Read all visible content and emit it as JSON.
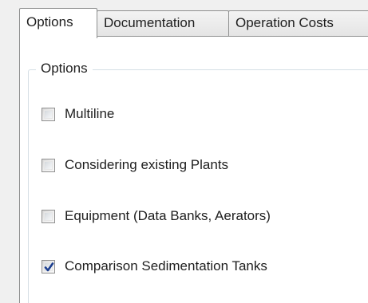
{
  "tabs": [
    {
      "label": "Options",
      "selected": true
    },
    {
      "label": "Documentation",
      "selected": false
    },
    {
      "label": "Operation Costs",
      "selected": false
    }
  ],
  "group": {
    "title": "Options"
  },
  "checkboxes": [
    {
      "label": "Multiline",
      "checked": false
    },
    {
      "label": "Considering existing Plants",
      "checked": false
    },
    {
      "label": "Equipment (Data Banks, Aerators)",
      "checked": false
    },
    {
      "label": "Comparison Sedimentation Tanks",
      "checked": true
    }
  ],
  "colors": {
    "checkmark": "#1d3f8f",
    "border": "#8e8f8f",
    "group_border": "#d5dfe5"
  }
}
